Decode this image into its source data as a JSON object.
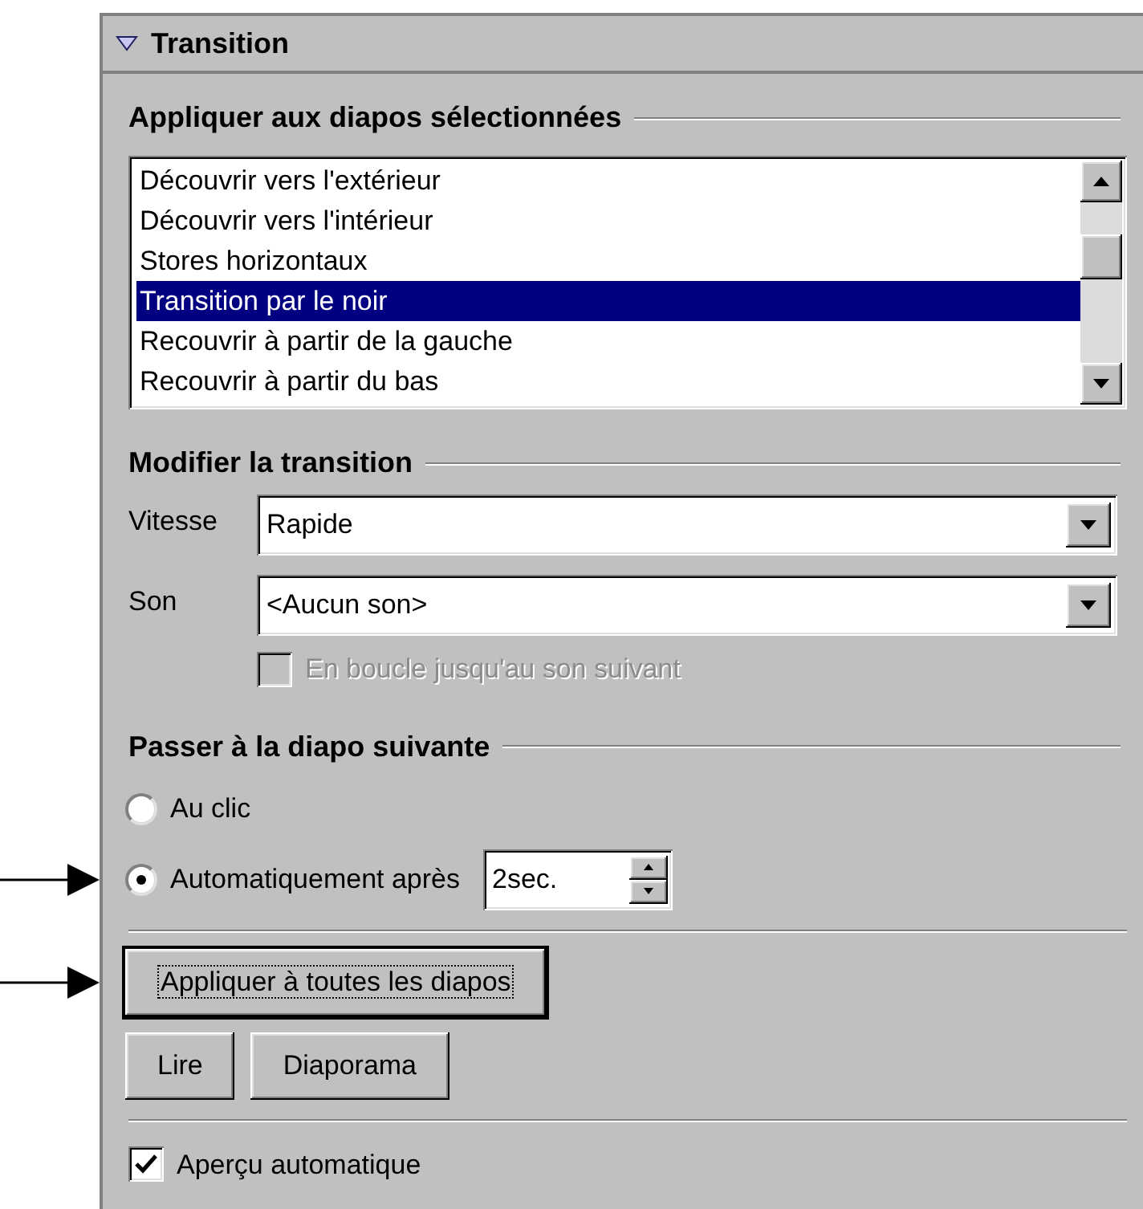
{
  "panel": {
    "title": "Transition",
    "expanded": true
  },
  "apply_section": {
    "heading": "Appliquer aux diapos sélectionnées",
    "effects": [
      {
        "label": "Découvrir vers l'extérieur",
        "selected": false
      },
      {
        "label": "Découvrir vers l'intérieur",
        "selected": false
      },
      {
        "label": "Stores horizontaux",
        "selected": false
      },
      {
        "label": "Transition par le noir",
        "selected": true
      },
      {
        "label": "Recouvrir à partir de la gauche",
        "selected": false
      },
      {
        "label": "Recouvrir à partir du bas",
        "selected": false
      }
    ]
  },
  "modify_section": {
    "heading": "Modifier la transition",
    "fields": [
      {
        "label": "Vitesse",
        "value": "Rapide"
      },
      {
        "label": "Son",
        "value": "<Aucun son>"
      }
    ],
    "loop_checkbox": {
      "label": "En boucle jusqu'au son suivant",
      "checked": false,
      "disabled": true
    }
  },
  "advance_section": {
    "heading": "Passer à la diapo suivante",
    "options": [
      {
        "label": "Au clic",
        "selected": false,
        "pointed": false
      },
      {
        "label": "Automatiquement après",
        "selected": true,
        "pointed": true,
        "spinner": "2sec."
      }
    ]
  },
  "buttons": [
    {
      "label": "Appliquer à toutes les diapos",
      "default": true,
      "pointed": true
    },
    {
      "label": "Lire",
      "default": false,
      "pointed": false
    },
    {
      "label": "Diaporama",
      "default": false,
      "pointed": false
    }
  ],
  "preview_checkbox": {
    "label": "Aperçu automatique",
    "checked": true,
    "disabled": false
  }
}
